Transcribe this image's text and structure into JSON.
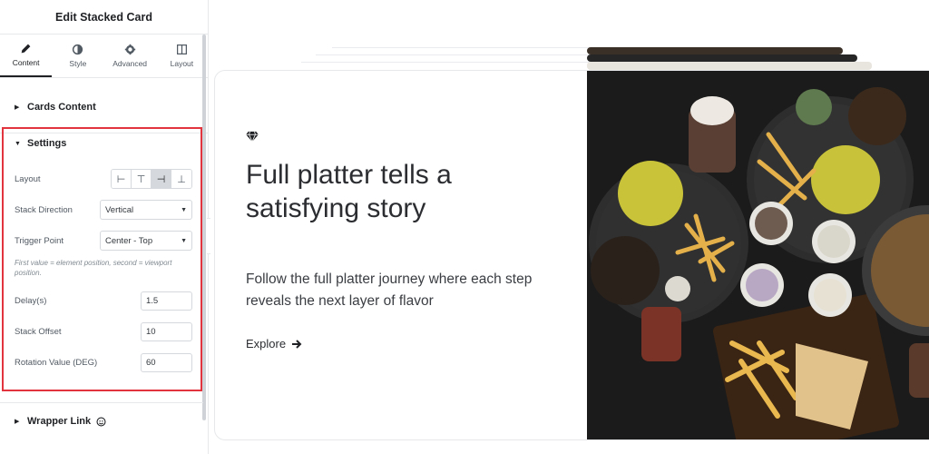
{
  "panel": {
    "title": "Edit Stacked Card",
    "tabs": [
      {
        "label": "Content",
        "icon": "pencil-icon",
        "active": true
      },
      {
        "label": "Style",
        "icon": "contrast-icon",
        "active": false
      },
      {
        "label": "Advanced",
        "icon": "gear-icon",
        "active": false
      },
      {
        "label": "Layout",
        "icon": "layout-icon",
        "active": false
      }
    ]
  },
  "sections": {
    "cards_content": "Cards Content",
    "settings": "Settings",
    "wrapper_link": "Wrapper Link"
  },
  "settings": {
    "layout_label": "Layout",
    "layout_options": [
      "⊢",
      "⊤",
      "⊣",
      "⊥"
    ],
    "layout_selected_index": 2,
    "stack_direction_label": "Stack Direction",
    "stack_direction_value": "Vertical",
    "trigger_point_label": "Trigger Point",
    "trigger_point_value": "Center - Top",
    "trigger_hint": "First value = element position, second = viewport position.",
    "delay_label": "Delay(s)",
    "delay_value": "1.5",
    "stack_offset_label": "Stack Offset",
    "stack_offset_value": "10",
    "rotation_label": "Rotation Value (DEG)",
    "rotation_value": "60"
  },
  "card": {
    "icon": "gem-icon",
    "title": "Full platter tells a satisfying story",
    "description": "Follow the full platter journey where each step reveals the next layer of flavor",
    "cta": "Explore",
    "cta_icon": "arrow-right-icon",
    "image": "food-platter-photo"
  },
  "colors": {
    "highlight": "#e1343f",
    "panel_text": "#1f2124",
    "photo_bg": "#1d1d1d"
  }
}
